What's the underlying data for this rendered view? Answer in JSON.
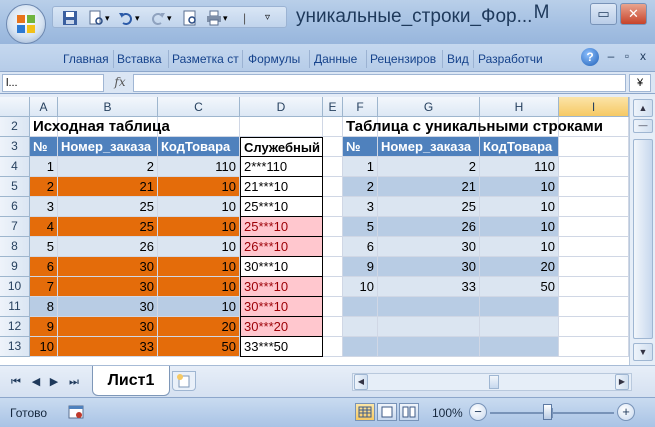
{
  "window": {
    "title": "уникальные_строки_Фор...",
    "minimize_label": "M",
    "restore_label": "▭",
    "close_label": "✕"
  },
  "ribbon": {
    "tabs": [
      "Главная",
      "Вставка",
      "Разметка ст",
      "Формулы",
      "Данные",
      "Рецензиров",
      "Вид",
      "Разработчи"
    ],
    "help_label": "?"
  },
  "formula_bar": {
    "name_box": "l...",
    "fx_label": "fx",
    "formula": "",
    "expand_label": "¥"
  },
  "grid": {
    "columns": [
      "A",
      "B",
      "C",
      "D",
      "E",
      "F",
      "G",
      "H",
      "I"
    ],
    "selected_column": "I",
    "rows": [
      "2",
      "3",
      "4",
      "5",
      "6",
      "7",
      "8",
      "9",
      "10",
      "11",
      "12",
      "13"
    ],
    "source_title": "Исходная таблица",
    "unique_title": "Таблица с уникальными строками",
    "source_headers": [
      "№",
      "Номер_заказа",
      "КодТовара",
      "Служебный"
    ],
    "unique_headers": [
      "№",
      "Номер_заказа",
      "КодТовара"
    ],
    "source_rows": [
      {
        "n": "1",
        "order": "2",
        "code": "110",
        "key": "2***110"
      },
      {
        "n": "2",
        "order": "21",
        "code": "10",
        "key": "21***10"
      },
      {
        "n": "3",
        "order": "25",
        "code": "10",
        "key": "25***10"
      },
      {
        "n": "4",
        "order": "25",
        "code": "10",
        "key": "25***10"
      },
      {
        "n": "5",
        "order": "26",
        "code": "10",
        "key": "26***10"
      },
      {
        "n": "6",
        "order": "30",
        "code": "10",
        "key": "30***10"
      },
      {
        "n": "7",
        "order": "30",
        "code": "10",
        "key": "30***10"
      },
      {
        "n": "8",
        "order": "30",
        "code": "10",
        "key": "30***10"
      },
      {
        "n": "9",
        "order": "30",
        "code": "20",
        "key": "30***20"
      },
      {
        "n": "10",
        "order": "33",
        "code": "50",
        "key": "33***50"
      }
    ],
    "unique_rows": [
      {
        "n": "1",
        "order": "2",
        "code": "110"
      },
      {
        "n": "2",
        "order": "21",
        "code": "10"
      },
      {
        "n": "3",
        "order": "25",
        "code": "10"
      },
      {
        "n": "5",
        "order": "26",
        "code": "10"
      },
      {
        "n": "6",
        "order": "30",
        "code": "10"
      },
      {
        "n": "9",
        "order": "30",
        "code": "20"
      },
      {
        "n": "10",
        "order": "33",
        "code": "50"
      },
      {
        "n": "",
        "order": "",
        "code": ""
      },
      {
        "n": "",
        "order": "",
        "code": ""
      },
      {
        "n": "",
        "order": "",
        "code": ""
      }
    ],
    "source_highlight_rows": [
      1,
      3,
      5,
      6,
      8,
      9
    ],
    "duplicate_rows": [
      3,
      4,
      6,
      7,
      8
    ]
  },
  "sheets": {
    "active": "Лист1"
  },
  "status": {
    "text": "Готово",
    "zoom": "100%",
    "zoom_value": 100
  },
  "colors": {
    "header_fill": "#4f81bd",
    "highlight_orange": "#e46c0a",
    "duplicate_pink": "#ffc7ce",
    "duplicate_text": "#9c0006",
    "band_light": "#dbe5f1",
    "band_dark": "#b8cce4"
  }
}
